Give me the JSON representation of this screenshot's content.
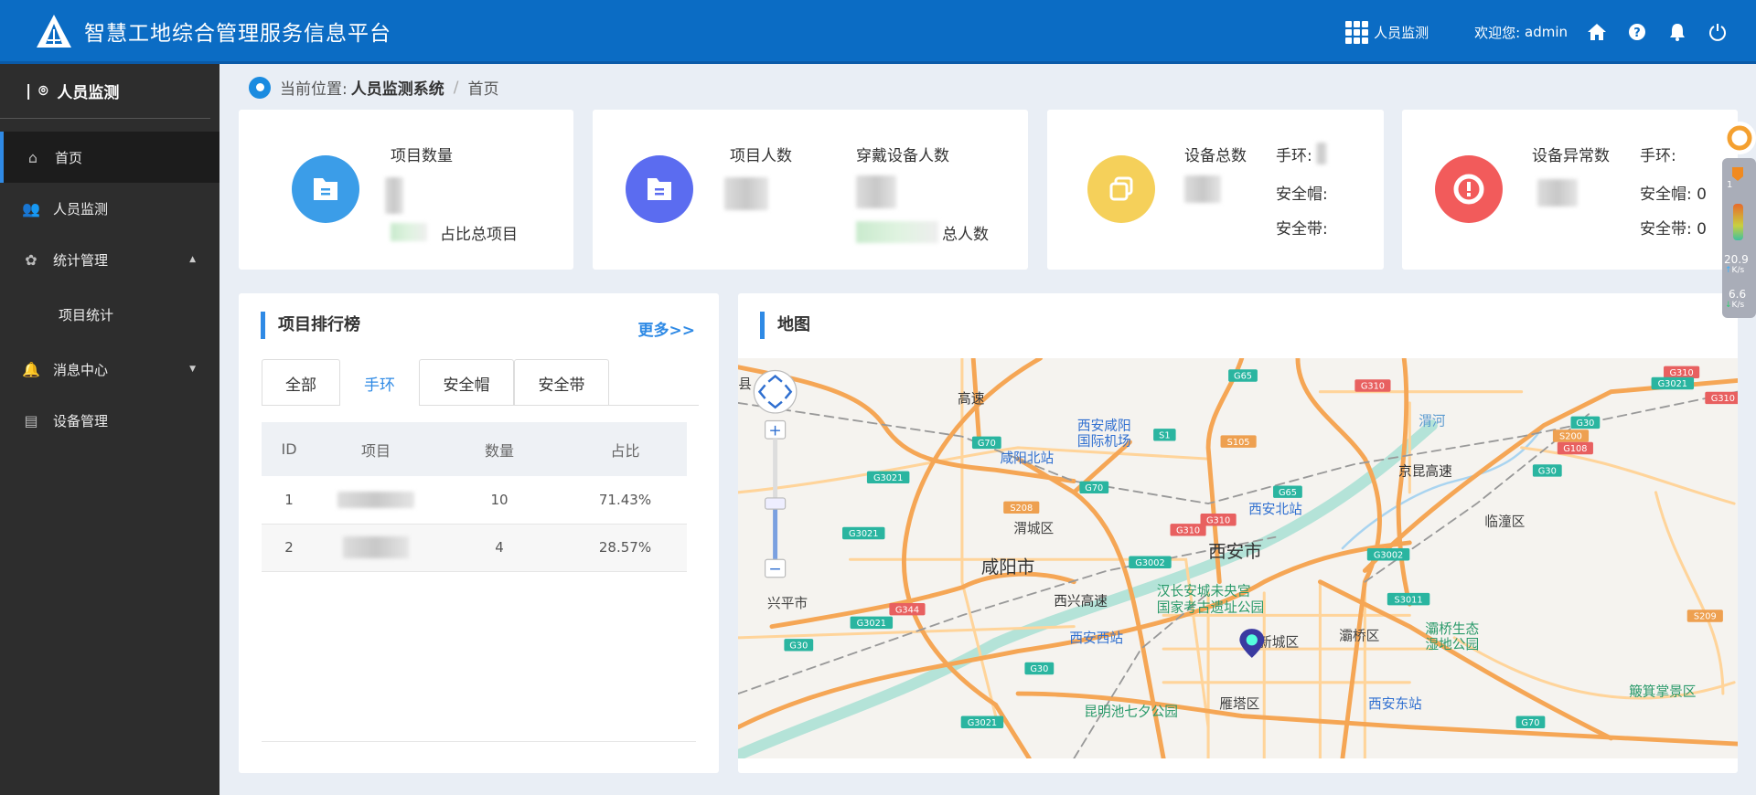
{
  "header": {
    "title": "智慧工地综合管理服务信息平台",
    "module": "人员监测",
    "welcome": "欢迎您:",
    "user": "admin",
    "icons": [
      "home-icon",
      "help-icon",
      "bell-icon",
      "power-icon"
    ],
    "color": "#0b6cc4"
  },
  "sidebar": {
    "section": "人员监测",
    "items": [
      {
        "label": "首页",
        "icon": "home-icon",
        "active": true
      },
      {
        "label": "人员监测",
        "icon": "users-icon"
      },
      {
        "label": "统计管理",
        "icon": "stats-icon",
        "expanded": true,
        "children": [
          {
            "label": "项目统计"
          }
        ]
      },
      {
        "label": "消息中心",
        "icon": "bell-icon",
        "expanded": false
      },
      {
        "label": "设备管理",
        "icon": "device-icon"
      }
    ]
  },
  "breadcrumb": {
    "prefix": "当前位置:",
    "system": "人员监测系统",
    "sep": "/",
    "page": "首页"
  },
  "cards": {
    "projects": {
      "label": "项目数量",
      "ratio_suffix": "占比总项目",
      "color": "#3b9de8"
    },
    "people": {
      "label": "项目人数",
      "label2": "穿戴设备人数",
      "ratio_suffix": "总人数",
      "color": "#5b6cf0"
    },
    "devices": {
      "label": "设备总数",
      "band": "手环:",
      "helmet": "安全帽:",
      "belt": "安全带:",
      "color": "#f5d05a"
    },
    "abnormal": {
      "label": "设备异常数",
      "band": "手环:",
      "helmet": "安全帽: 0",
      "belt": "安全带: 0",
      "color": "#f25b5b"
    }
  },
  "ranking": {
    "title": "项目排行榜",
    "more": "更多>>",
    "tabs": [
      "全部",
      "手环",
      "安全帽",
      "安全带"
    ],
    "active_tab": "手环",
    "columns": [
      "ID",
      "项目",
      "数量",
      "占比"
    ],
    "rows": [
      {
        "id": "1",
        "count": "10",
        "ratio": "71.43%"
      },
      {
        "id": "2",
        "count": "4",
        "ratio": "28.57%"
      }
    ]
  },
  "map": {
    "title": "地图",
    "places": [
      "西安咸阳",
      "国际机场",
      "咸阳北站",
      "渭城区",
      "咸阳市",
      "西安市",
      "西兴高速",
      "汉长安城未央宫",
      "国家考古遗址公园",
      "西安西站",
      "新城区",
      "灞桥区",
      "灞桥生态",
      "湿地公园",
      "临潼区",
      "京昆高速",
      "西安北站",
      "雁塔区",
      "西安东站",
      "昆明池七夕公园",
      "簸箕掌景区",
      "兴平市",
      "县",
      "渭河",
      "高速"
    ],
    "shields": [
      "G65",
      "G70",
      "S1",
      "S105",
      "G3021",
      "G70",
      "S208",
      "G3021",
      "G310",
      "G310",
      "G65",
      "G3002",
      "G344",
      "G3021",
      "G30",
      "G30",
      "G3021",
      "G310",
      "G310",
      "G3021",
      "G310",
      "G30",
      "S200",
      "G108",
      "G30",
      "G3002",
      "S3011",
      "S209",
      "G70"
    ]
  },
  "widget": {
    "up": "20.9",
    "down": "6.6",
    "unit": "K/s",
    "badge": "1"
  }
}
